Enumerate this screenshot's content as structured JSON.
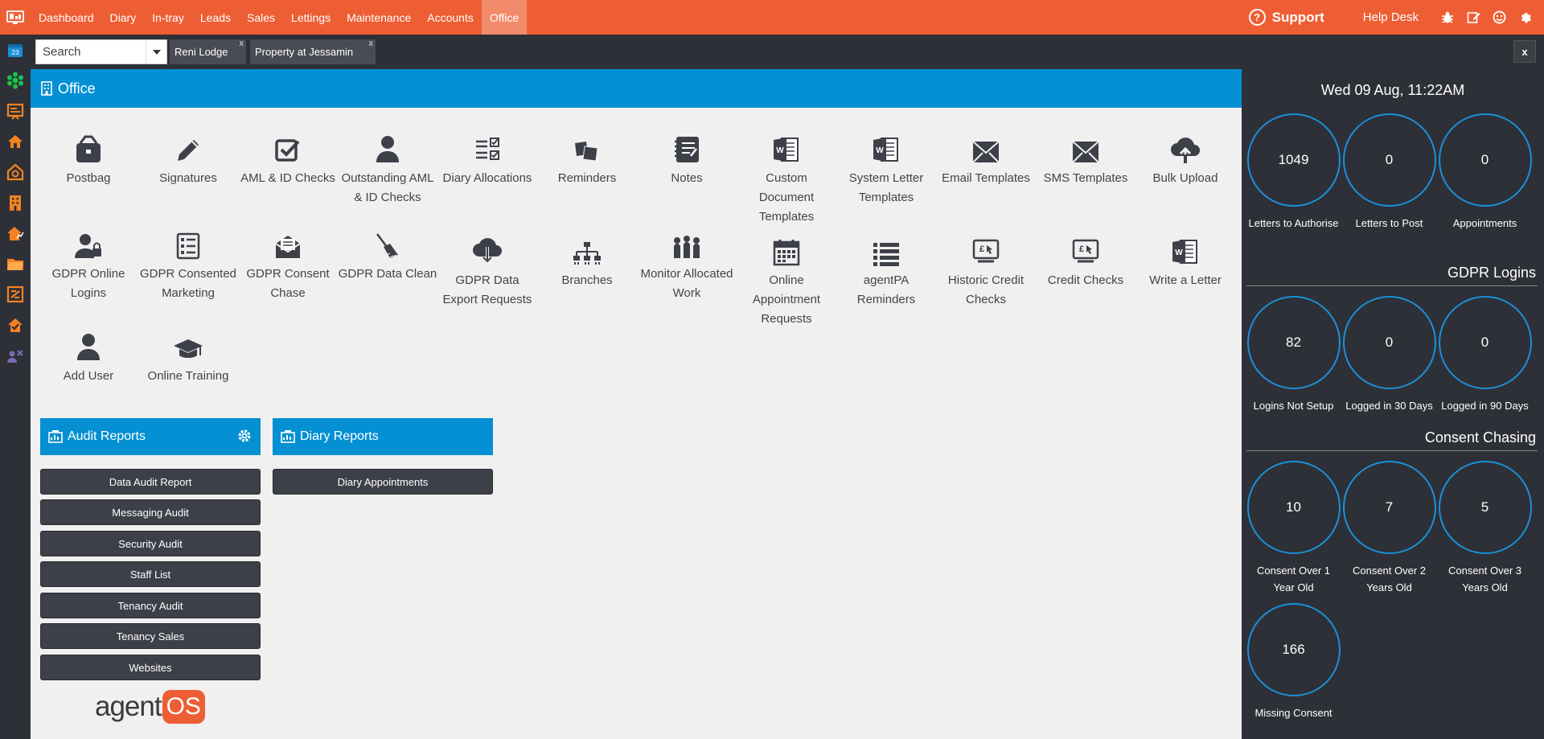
{
  "nav": {
    "items": [
      "Dashboard",
      "Diary",
      "In-tray",
      "Leads",
      "Sales",
      "Lettings",
      "Maintenance",
      "Accounts",
      "Office"
    ],
    "active": "Office",
    "support_label": "Support",
    "helpdesk_label": "Help Desk"
  },
  "tabbar": {
    "search_label": "Search",
    "tabs": [
      {
        "label": "Reni Lodge",
        "close": "x"
      },
      {
        "label": "Property at Jessamin",
        "close": "x"
      }
    ],
    "close_all": "x"
  },
  "office": {
    "title": "Office",
    "tiles": [
      "Postbag",
      "Signatures",
      "AML & ID Checks",
      "Outstanding AML & ID Checks",
      "Diary Allocations",
      "Reminders",
      "Notes",
      "Custom Document Templates",
      "System Letter Templates",
      "Email Templates",
      "SMS Templates",
      "Bulk Upload",
      "GDPR Online Logins",
      "GDPR Consented Marketing",
      "GDPR Consent Chase",
      "GDPR Data Clean",
      "GDPR Data Export Requests",
      "Branches",
      "Monitor Allocated Work",
      "Online Appointment Requests",
      "agentPA Reminders",
      "Historic Credit Checks",
      "Credit Checks",
      "Write a Letter",
      "Add User",
      "Online Training"
    ]
  },
  "audit_reports": {
    "title": "Audit Reports",
    "buttons": [
      "Data Audit Report",
      "Messaging Audit",
      "Security Audit",
      "Staff List",
      "Tenancy Audit",
      "Tenancy Sales",
      "Websites"
    ]
  },
  "diary_reports": {
    "title": "Diary Reports",
    "buttons": [
      "Diary Appointments"
    ]
  },
  "brand": {
    "agent": "agent",
    "os": "OS"
  },
  "panel": {
    "datetime": "Wed 09 Aug, 11:22AM",
    "stats_top": [
      {
        "value": "1049",
        "label": "Letters to Authorise"
      },
      {
        "value": "0",
        "label": "Letters to Post"
      },
      {
        "value": "0",
        "label": "Appointments"
      }
    ],
    "gdpr_title": "GDPR Logins",
    "gdpr_stats": [
      {
        "value": "82",
        "label": "Logins Not Setup"
      },
      {
        "value": "0",
        "label": "Logged in 30 Days"
      },
      {
        "value": "0",
        "label": "Logged in 90 Days"
      }
    ],
    "consent_title": "Consent Chasing",
    "consent_stats": [
      {
        "value": "10",
        "label": "Consent Over 1 Year Old"
      },
      {
        "value": "7",
        "label": "Consent Over 2 Years Old"
      },
      {
        "value": "5",
        "label": "Consent Over 3 Years Old"
      },
      {
        "value": "166",
        "label": "Missing Consent"
      }
    ]
  },
  "colors": {
    "brand": "#ee5e34",
    "accent": "#0490d3",
    "dark": "#2e3038",
    "ring": "#1a91d8"
  }
}
